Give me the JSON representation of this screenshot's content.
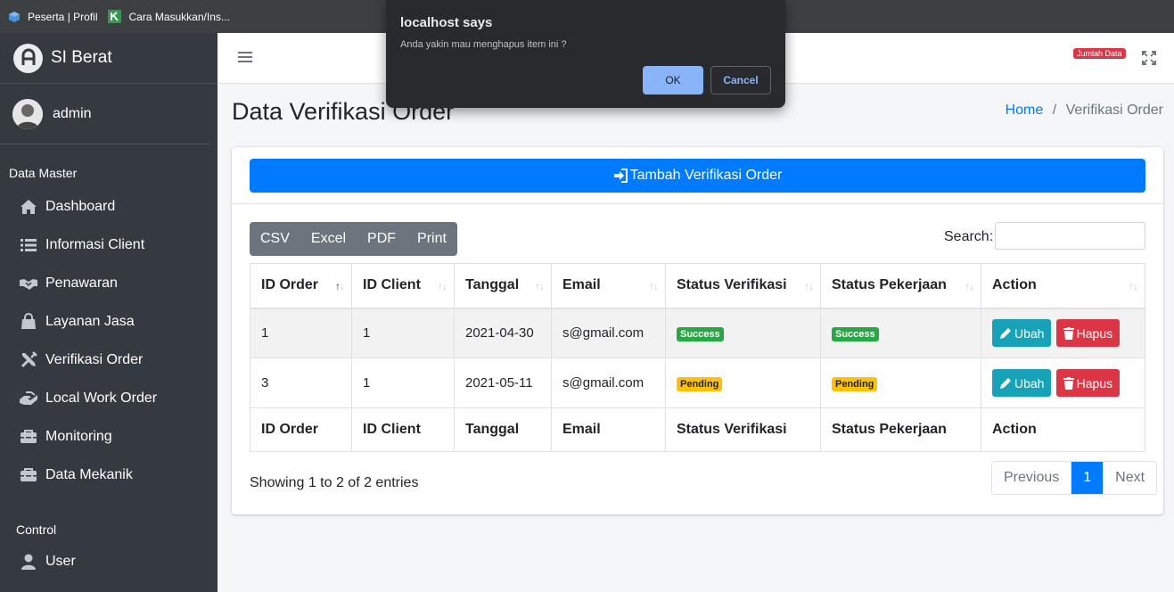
{
  "bookmarks": [
    {
      "label": "Peserta | Profil",
      "icon": "cube-icon"
    },
    {
      "label": "Cara Masukkan/Ins...",
      "icon": "k-logo-icon"
    }
  ],
  "sidebar": {
    "brand": "SI Berat",
    "user": "admin",
    "section_master": "Data Master",
    "items": [
      {
        "label": "Dashboard",
        "icon": "home-icon"
      },
      {
        "label": "Informasi Client",
        "icon": "list-icon"
      },
      {
        "label": "Penawaran",
        "icon": "handshake-icon"
      },
      {
        "label": "Layanan Jasa",
        "icon": "shopping-bag-icon"
      },
      {
        "label": "Verifikasi Order",
        "icon": "tools-icon"
      },
      {
        "label": "Local Work Order",
        "icon": "hands-helping-icon"
      },
      {
        "label": "Monitoring",
        "icon": "toolbox-icon"
      },
      {
        "label": "Data Mekanik",
        "icon": "toolbox-icon"
      }
    ],
    "section_control": "Control",
    "control_items": [
      {
        "label": "User",
        "icon": "user-icon"
      }
    ]
  },
  "topbar": {
    "badge": "Jumlah Data"
  },
  "page": {
    "title": "Data Verifikasi Order",
    "breadcrumb_home": "Home",
    "breadcrumb_sep": "/",
    "breadcrumb_current": "Verifikasi Order",
    "add_button": "Tambah Verifikasi Order"
  },
  "datatable": {
    "buttons": [
      "CSV",
      "Excel",
      "PDF",
      "Print"
    ],
    "search_label": "Search:",
    "search_value": "",
    "columns": [
      "ID Order",
      "ID Client",
      "Tanggal",
      "Email",
      "Status Verifikasi",
      "Status Pekerjaan",
      "Action"
    ],
    "rows": [
      {
        "id_order": "1",
        "id_client": "1",
        "tanggal": "2021-04-30",
        "email": "s@gmail.com",
        "status_verifikasi": "Success",
        "status_pekerjaan": "Success"
      },
      {
        "id_order": "3",
        "id_client": "1",
        "tanggal": "2021-05-11",
        "email": "s@gmail.com",
        "status_verifikasi": "Pending",
        "status_pekerjaan": "Pending"
      }
    ],
    "edit_label": "Ubah",
    "delete_label": "Hapus",
    "info": "Showing 1 to 2 of 2 entries",
    "pagination": {
      "previous": "Previous",
      "current": "1",
      "next": "Next"
    }
  },
  "dialog": {
    "title": "localhost says",
    "message": "Anda yakin mau menghapus item ini ?",
    "ok": "OK",
    "cancel": "Cancel"
  },
  "colors": {
    "primary": "#007bff",
    "success": "#28a745",
    "warning": "#ffc107",
    "danger": "#dc3545",
    "info": "#17a2b8",
    "sidebar": "#343a40"
  }
}
